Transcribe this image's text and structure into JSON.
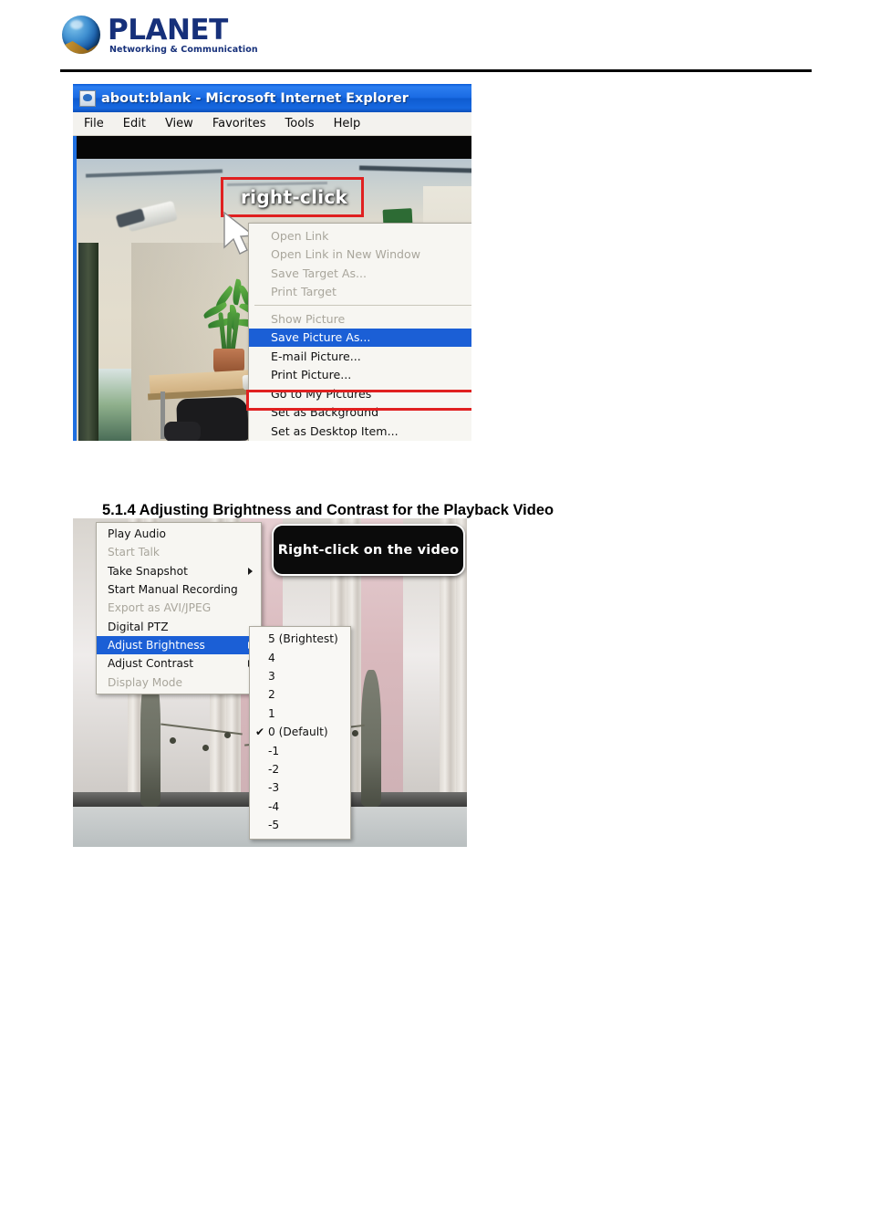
{
  "brand": {
    "name": "PLANET",
    "tagline": "Networking & Communication",
    "logo_icon": "planet-globe-icon",
    "word_color": "#16307a"
  },
  "figure_ie": {
    "window_title": "about:blank - Microsoft Internet Explorer",
    "title_icon": "ie-page-icon",
    "menubar": [
      "File",
      "Edit",
      "View",
      "Favorites",
      "Tools",
      "Help"
    ],
    "window_buttons": [
      {
        "name": "minimize-button",
        "icon": "minimize-icon"
      },
      {
        "name": "maximize-button",
        "icon": "maximize-icon"
      }
    ],
    "annotation": {
      "label": "right-click",
      "box_color": "#e02020",
      "cursor_icon": "mouse-pointer-icon"
    },
    "context_menu": [
      {
        "label": "Open Link",
        "state": "disabled",
        "separator_after": false
      },
      {
        "label": "Open Link in New Window",
        "state": "disabled",
        "separator_after": false
      },
      {
        "label": "Save Target As...",
        "state": "disabled",
        "separator_after": false
      },
      {
        "label": "Print Target",
        "state": "disabled",
        "separator_after": true
      },
      {
        "label": "Show Picture",
        "state": "disabled",
        "separator_after": false
      },
      {
        "label": "Save Picture As...",
        "state": "selected",
        "separator_after": false
      },
      {
        "label": "E-mail Picture...",
        "state": "normal",
        "separator_after": false
      },
      {
        "label": "Print Picture...",
        "state": "normal",
        "separator_after": false
      },
      {
        "label": "Go to My Pictures",
        "state": "normal",
        "separator_after": false
      },
      {
        "label": "Set as Background",
        "state": "normal",
        "separator_after": false
      },
      {
        "label": "Set as Desktop Item...",
        "state": "normal",
        "separator_after": false
      }
    ],
    "highlight_color": "#1b5fd6",
    "highlight_box_color": "#e02020"
  },
  "section": {
    "heading": "5.1.4 Adjusting Brightness and Contrast for the Playback Video"
  },
  "figure_playback": {
    "callout": "Right-click on the video",
    "context_menu": [
      {
        "label": "Play Audio",
        "state": "normal",
        "submenu": false
      },
      {
        "label": "Start Talk",
        "state": "disabled",
        "submenu": false
      },
      {
        "label": "Take Snapshot",
        "state": "normal",
        "submenu": true
      },
      {
        "label": "Start Manual Recording",
        "state": "normal",
        "submenu": false
      },
      {
        "label": "Export as AVI/JPEG",
        "state": "disabled",
        "submenu": false
      },
      {
        "label": "Digital PTZ",
        "state": "normal",
        "submenu": false
      },
      {
        "label": "Adjust Brightness",
        "state": "selected",
        "submenu": true
      },
      {
        "label": "Adjust Contrast",
        "state": "normal",
        "submenu": true
      },
      {
        "label": "Display Mode",
        "state": "disabled",
        "submenu": false
      }
    ],
    "brightness_submenu": [
      {
        "label": "5 (Brightest)",
        "checked": false
      },
      {
        "label": "4",
        "checked": false
      },
      {
        "label": "3",
        "checked": false
      },
      {
        "label": "2",
        "checked": false
      },
      {
        "label": "1",
        "checked": false
      },
      {
        "label": "0 (Default)",
        "checked": true
      },
      {
        "label": "-1",
        "checked": false
      },
      {
        "label": "-2",
        "checked": false
      },
      {
        "label": "-3",
        "checked": false
      },
      {
        "label": "-4",
        "checked": false
      },
      {
        "label": "-5",
        "checked": false
      }
    ],
    "check_glyph": "✔"
  }
}
